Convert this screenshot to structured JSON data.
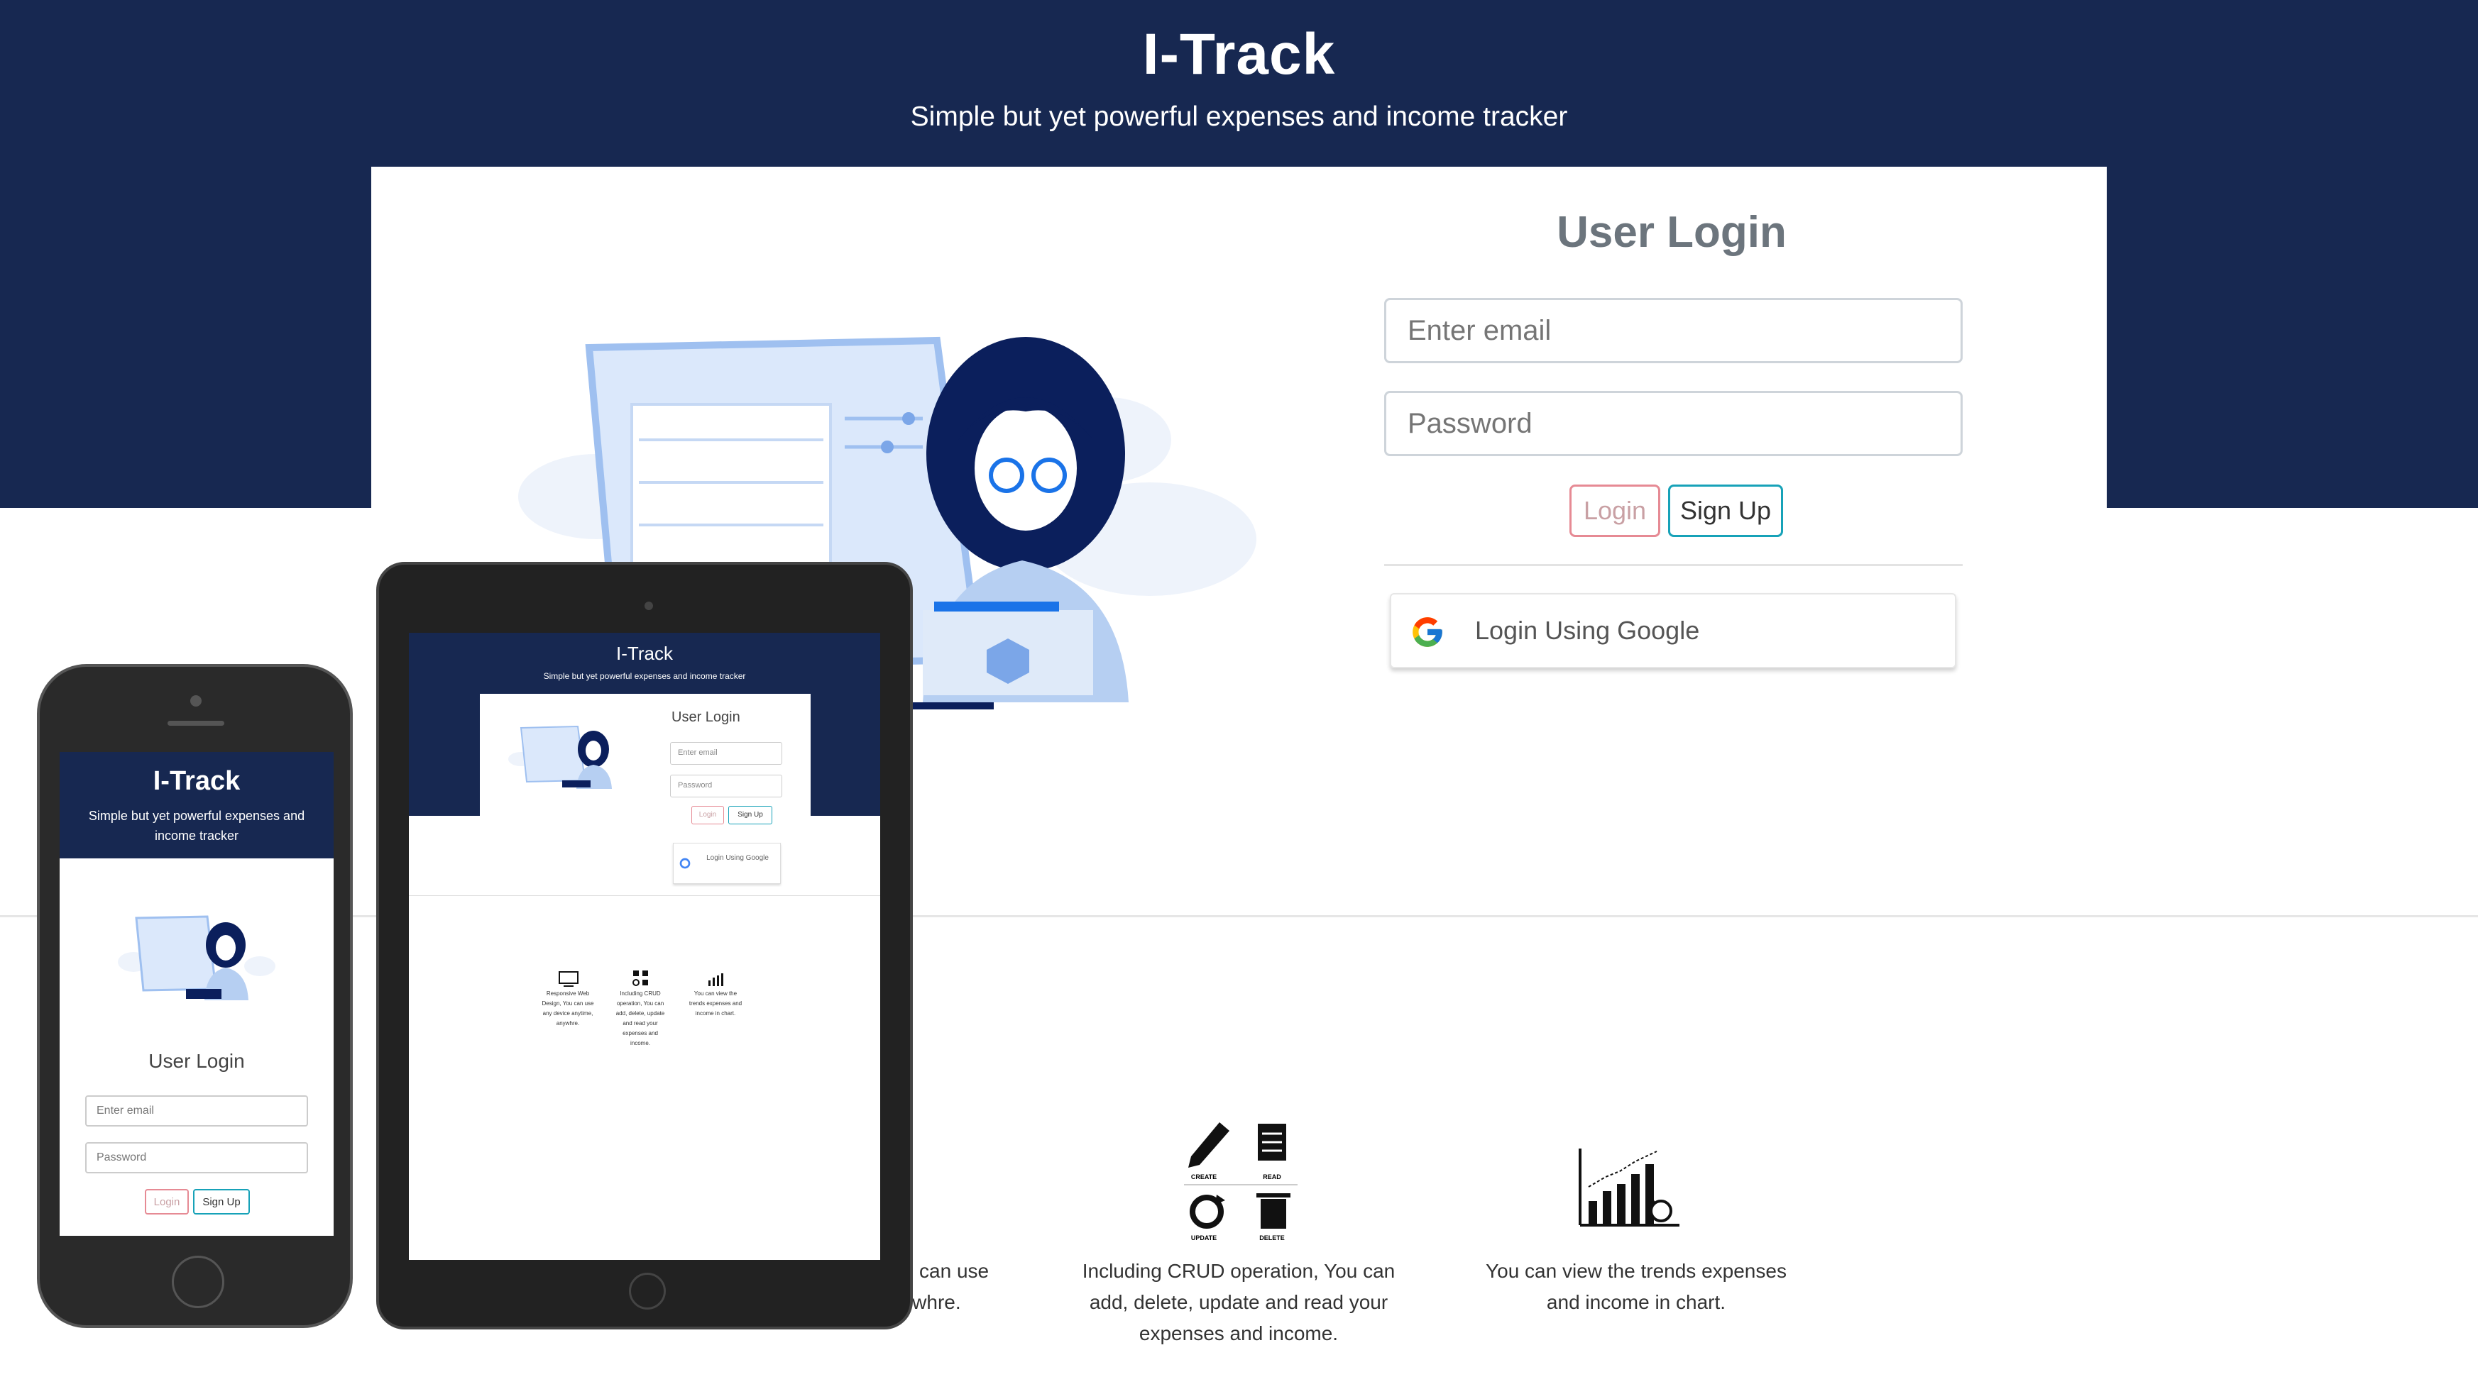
{
  "header": {
    "title": "I-Track",
    "subtitle": "Simple but yet powerful expenses and income tracker"
  },
  "login": {
    "title": "User Login",
    "email_placeholder": "Enter email",
    "password_placeholder": "Password",
    "login_label": "Login",
    "signup_label": "Sign Up",
    "google_label": "Login Using Google"
  },
  "features": [
    {
      "text": "You can use anywhre."
    },
    {
      "text": "Including CRUD operation, You can add, delete, update and read your expenses and income.",
      "labels": [
        "CREATE",
        "READ",
        "UPDATE",
        "DELETE"
      ]
    },
    {
      "text": "You can view the trends expenses and income in chart."
    }
  ],
  "mockups": {
    "tablet": {
      "title": "I-Track",
      "subtitle": "Simple but yet powerful expenses and income tracker",
      "login_title": "User Login",
      "email_placeholder": "Enter email",
      "password_placeholder": "Password",
      "login_label": "Login",
      "signup_label": "Sign Up",
      "google_label": "Login Using Google",
      "features": [
        "Responsive Web Design, You can use any device anytime, anywhre.",
        "Including CRUD operation, You can add, delete, update and read your expenses and income.",
        "You can view the trends expenses and income in chart."
      ]
    },
    "phone": {
      "title": "I-Track",
      "subtitle": "Simple but yet powerful expenses and income tracker",
      "login_title": "User Login",
      "email_placeholder": "Enter email",
      "password_placeholder": "Password",
      "login_label": "Login",
      "signup_label": "Sign Up"
    }
  },
  "colors": {
    "navy": "#172851",
    "login_border": "#e68a94",
    "signup_border": "#17a2b8"
  }
}
